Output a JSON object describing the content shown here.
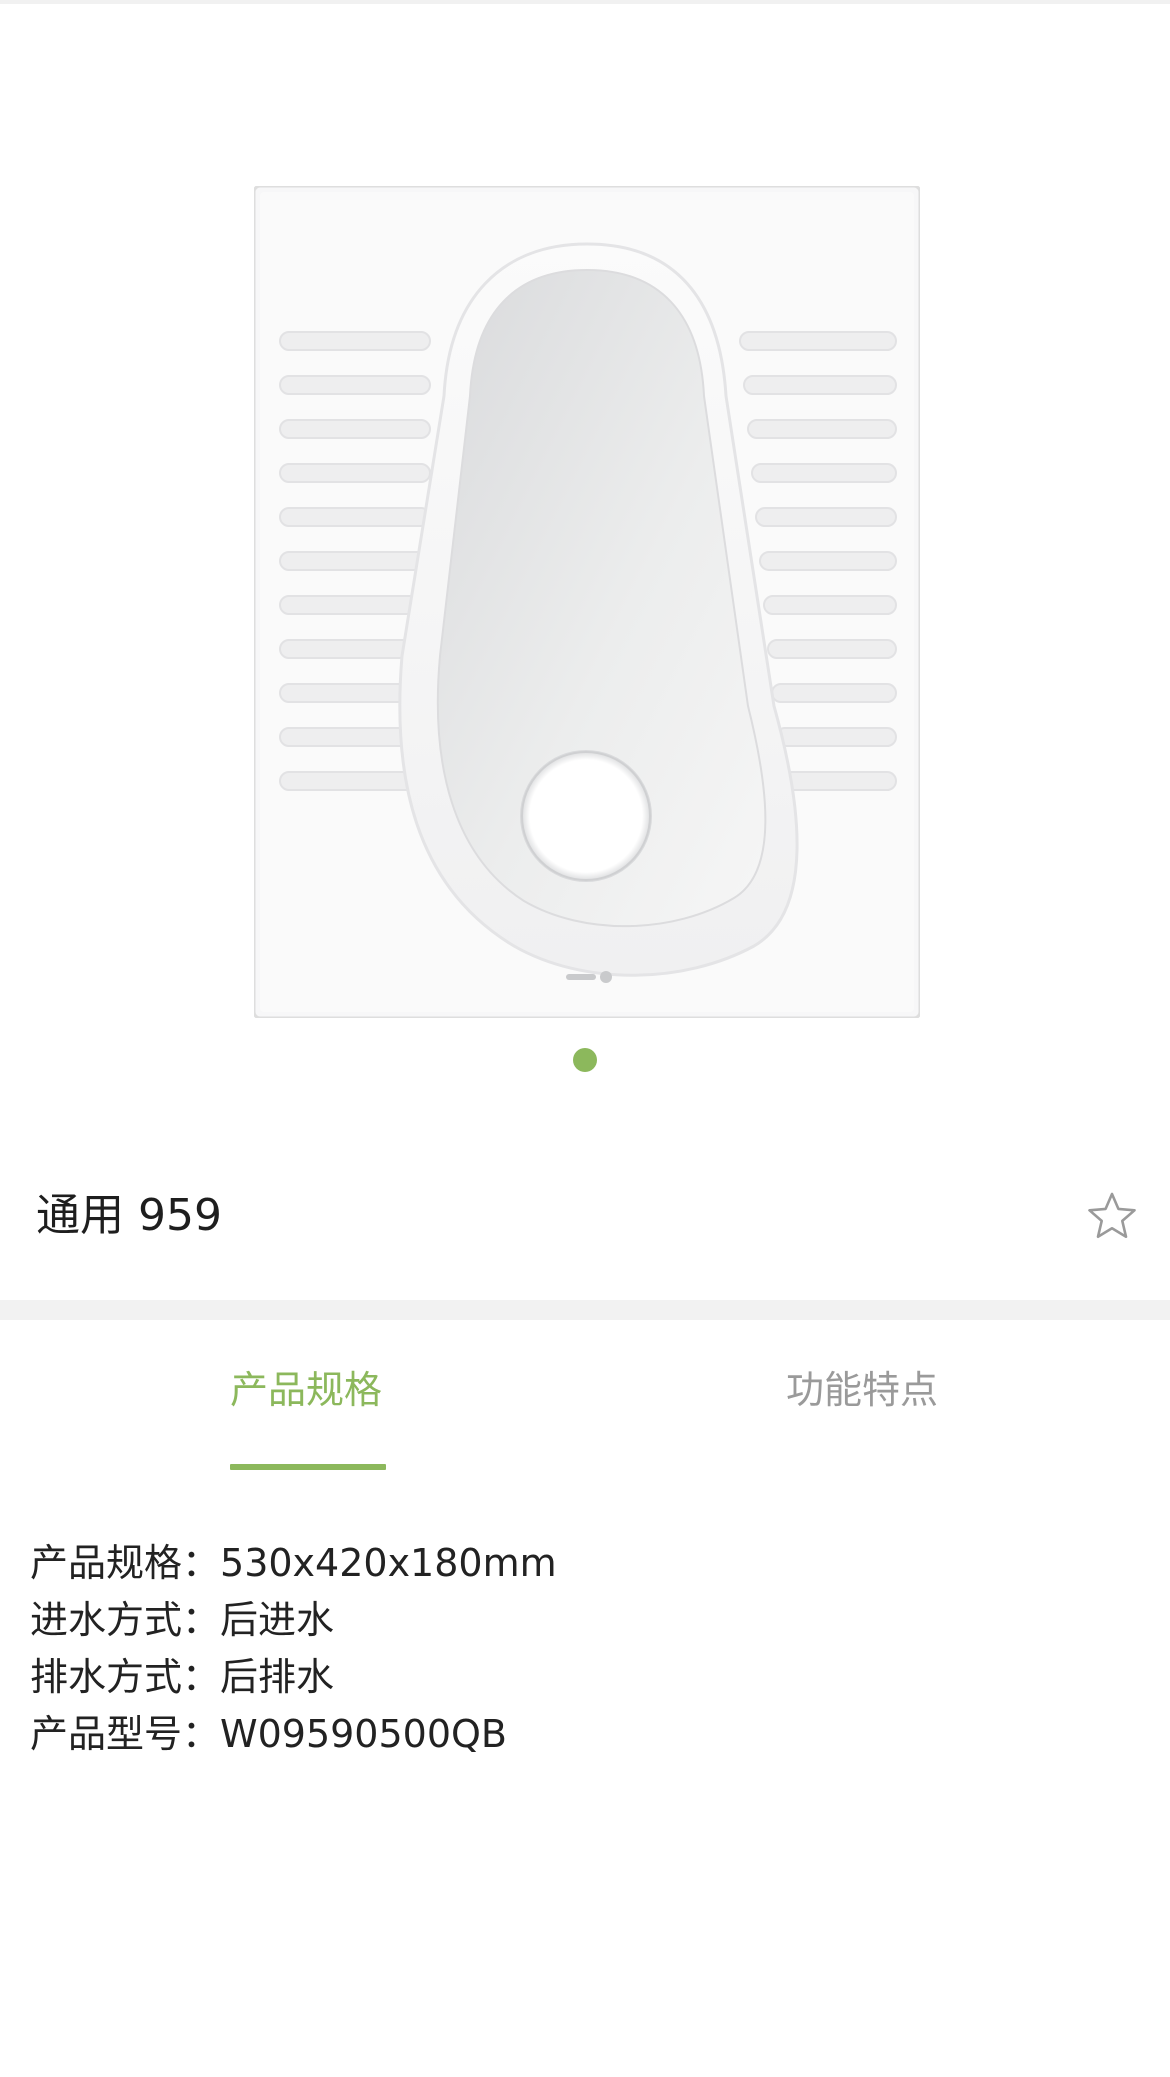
{
  "colors": {
    "accent": "#8cb85c",
    "inactive_tab": "#9a9a9a",
    "text": "#222222",
    "divider": "#f2f2f2"
  },
  "gallery": {
    "image_name": "squat-toilet-photo",
    "current_page": 1,
    "page_count": 1
  },
  "product": {
    "title": "通用 959",
    "favorite_icon": "star-outline-icon"
  },
  "tabs": [
    {
      "label": "产品规格",
      "active": true
    },
    {
      "label": "功能特点",
      "active": false
    }
  ],
  "specs": {
    "separator": "：",
    "rows": [
      {
        "label": "产品规格",
        "value": "530x420x180mm"
      },
      {
        "label": "进水方式",
        "value": "后进水"
      },
      {
        "label": "排水方式",
        "value": "后排水"
      },
      {
        "label": "产品型号",
        "value": "W09590500QB"
      }
    ]
  }
}
